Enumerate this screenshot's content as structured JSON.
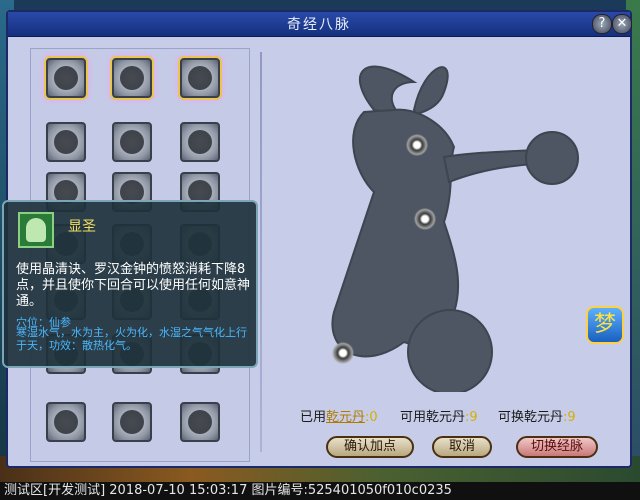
{
  "window": {
    "title": "奇经八脉",
    "help_label": "?",
    "close_label": "✕"
  },
  "skills": [
    {
      "icon": "swirl-icon",
      "lit": true
    },
    {
      "icon": "claw-icon",
      "lit": true
    },
    {
      "icon": "flower-icon",
      "lit": true
    },
    {
      "icon": "fist-icon",
      "lit": false
    },
    {
      "icon": "bell-icon",
      "lit": false
    },
    {
      "icon": "figure-icon",
      "lit": false
    },
    {
      "icon": "hand-icon",
      "lit": false
    },
    {
      "icon": "ladder-icon",
      "lit": false
    },
    {
      "icon": "monk-icon",
      "lit": false
    },
    {
      "icon": "wave-icon",
      "lit": false
    },
    {
      "icon": "wheel-icon",
      "lit": false
    },
    {
      "icon": "sword-icon",
      "lit": false
    },
    {
      "icon": "fire-icon",
      "lit": false
    },
    {
      "icon": "eye-icon",
      "lit": false
    },
    {
      "icon": "moon-icon",
      "lit": false
    },
    {
      "icon": "pot-icon",
      "lit": false
    },
    {
      "icon": "staff-icon",
      "lit": false
    },
    {
      "icon": "shield-icon",
      "lit": false
    },
    {
      "icon": "lotus-icon",
      "lit": false
    },
    {
      "icon": "spiral-icon",
      "lit": false
    },
    {
      "icon": "dancer-icon",
      "lit": false
    }
  ],
  "tooltip": {
    "name": "显圣",
    "description": "使用晶清诀、罗汉金钟的愤怒消耗下降8点，并且使你下回合可以使用任何如意神通。",
    "location": "穴位：仙参",
    "elements": "寒湿水气，水为主，火为化，水湿之气气化上行于天，功效：散热化气。"
  },
  "stats": {
    "used_label": "已用",
    "used_link": "乾元丹",
    "used_value": ":0",
    "available_label": "可用乾元丹",
    "available_value": ":9",
    "exchange_label": "可换乾元丹",
    "exchange_value": ":9"
  },
  "buttons": {
    "confirm": "确认加点",
    "cancel": "取消",
    "switch": "切换经脉"
  },
  "side": {
    "dream_glyph": "梦"
  },
  "status_bar": "测试区[开发测试] 2018-07-10 15:03:17 图片编号:525401050f010c0235"
}
